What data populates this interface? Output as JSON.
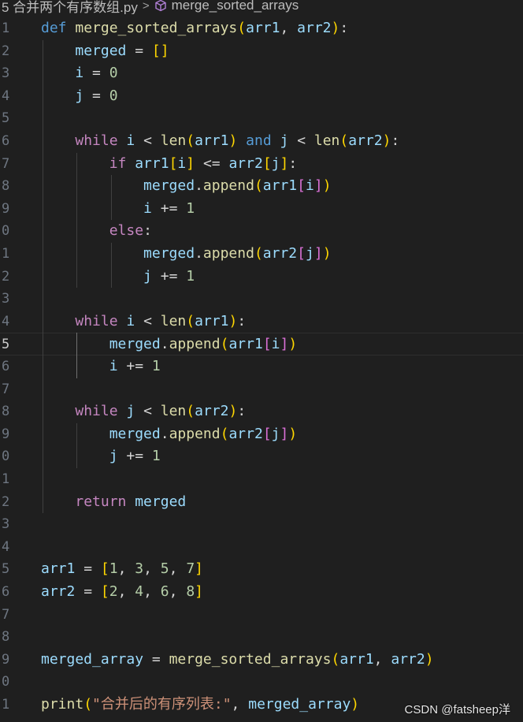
{
  "breadcrumb": {
    "file": "5 合并两个有序数组.py",
    "symbol": "merge_sorted_arrays"
  },
  "line_numbers": [
    "1",
    "2",
    "3",
    "4",
    "5",
    "6",
    "7",
    "8",
    "9",
    "0",
    "1",
    "2",
    "3",
    "4",
    "5",
    "6",
    "7",
    "8",
    "9",
    "0",
    "1",
    "2",
    "3",
    "4",
    "5",
    "6",
    "7",
    "8",
    "9",
    "0",
    "1"
  ],
  "active_line_index": 14,
  "code_lines": [
    [
      [
        "kw",
        "def "
      ],
      [
        "fn",
        "merge_sorted_arrays"
      ],
      [
        "b1",
        "("
      ],
      [
        "var",
        "arr1"
      ],
      [
        "op",
        ", "
      ],
      [
        "var",
        "arr2"
      ],
      [
        "b1",
        ")"
      ],
      [
        "op",
        ":"
      ]
    ],
    [
      [
        "op",
        "    "
      ],
      [
        "var",
        "merged"
      ],
      [
        "op",
        " = "
      ],
      [
        "b1",
        "[]"
      ]
    ],
    [
      [
        "op",
        "    "
      ],
      [
        "var",
        "i"
      ],
      [
        "op",
        " = "
      ],
      [
        "num",
        "0"
      ]
    ],
    [
      [
        "op",
        "    "
      ],
      [
        "var",
        "j"
      ],
      [
        "op",
        " = "
      ],
      [
        "num",
        "0"
      ]
    ],
    [],
    [
      [
        "op",
        "    "
      ],
      [
        "ctl",
        "while "
      ],
      [
        "var",
        "i"
      ],
      [
        "op",
        " < "
      ],
      [
        "fn",
        "len"
      ],
      [
        "b1",
        "("
      ],
      [
        "var",
        "arr1"
      ],
      [
        "b1",
        ")"
      ],
      [
        "op",
        " "
      ],
      [
        "kw",
        "and"
      ],
      [
        "op",
        " "
      ],
      [
        "var",
        "j"
      ],
      [
        "op",
        " < "
      ],
      [
        "fn",
        "len"
      ],
      [
        "b1",
        "("
      ],
      [
        "var",
        "arr2"
      ],
      [
        "b1",
        ")"
      ],
      [
        "op",
        ":"
      ]
    ],
    [
      [
        "op",
        "        "
      ],
      [
        "ctl",
        "if "
      ],
      [
        "var",
        "arr1"
      ],
      [
        "b1",
        "["
      ],
      [
        "var",
        "i"
      ],
      [
        "b1",
        "]"
      ],
      [
        "op",
        " <= "
      ],
      [
        "var",
        "arr2"
      ],
      [
        "b1",
        "["
      ],
      [
        "var",
        "j"
      ],
      [
        "b1",
        "]"
      ],
      [
        "op",
        ":"
      ]
    ],
    [
      [
        "op",
        "            "
      ],
      [
        "var",
        "merged"
      ],
      [
        "op",
        "."
      ],
      [
        "fn",
        "append"
      ],
      [
        "b1",
        "("
      ],
      [
        "var",
        "arr1"
      ],
      [
        "b2",
        "["
      ],
      [
        "var",
        "i"
      ],
      [
        "b2",
        "]"
      ],
      [
        "b1",
        ")"
      ]
    ],
    [
      [
        "op",
        "            "
      ],
      [
        "var",
        "i"
      ],
      [
        "op",
        " += "
      ],
      [
        "num",
        "1"
      ]
    ],
    [
      [
        "op",
        "        "
      ],
      [
        "ctl",
        "else"
      ],
      [
        "op",
        ":"
      ]
    ],
    [
      [
        "op",
        "            "
      ],
      [
        "var",
        "merged"
      ],
      [
        "op",
        "."
      ],
      [
        "fn",
        "append"
      ],
      [
        "b1",
        "("
      ],
      [
        "var",
        "arr2"
      ],
      [
        "b2",
        "["
      ],
      [
        "var",
        "j"
      ],
      [
        "b2",
        "]"
      ],
      [
        "b1",
        ")"
      ]
    ],
    [
      [
        "op",
        "            "
      ],
      [
        "var",
        "j"
      ],
      [
        "op",
        " += "
      ],
      [
        "num",
        "1"
      ]
    ],
    [],
    [
      [
        "op",
        "    "
      ],
      [
        "ctl",
        "while "
      ],
      [
        "var",
        "i"
      ],
      [
        "op",
        " < "
      ],
      [
        "fn",
        "len"
      ],
      [
        "b1",
        "("
      ],
      [
        "var",
        "arr1"
      ],
      [
        "b1",
        ")"
      ],
      [
        "op",
        ":"
      ]
    ],
    [
      [
        "op",
        "        "
      ],
      [
        "var",
        "merged"
      ],
      [
        "op",
        "."
      ],
      [
        "fn",
        "append"
      ],
      [
        "b1",
        "("
      ],
      [
        "var",
        "arr1"
      ],
      [
        "b2",
        "["
      ],
      [
        "var",
        "i"
      ],
      [
        "b2",
        "]"
      ],
      [
        "b1",
        ")"
      ]
    ],
    [
      [
        "op",
        "        "
      ],
      [
        "var",
        "i"
      ],
      [
        "op",
        " += "
      ],
      [
        "num",
        "1"
      ]
    ],
    [],
    [
      [
        "op",
        "    "
      ],
      [
        "ctl",
        "while "
      ],
      [
        "var",
        "j"
      ],
      [
        "op",
        " < "
      ],
      [
        "fn",
        "len"
      ],
      [
        "b1",
        "("
      ],
      [
        "var",
        "arr2"
      ],
      [
        "b1",
        ")"
      ],
      [
        "op",
        ":"
      ]
    ],
    [
      [
        "op",
        "        "
      ],
      [
        "var",
        "merged"
      ],
      [
        "op",
        "."
      ],
      [
        "fn",
        "append"
      ],
      [
        "b1",
        "("
      ],
      [
        "var",
        "arr2"
      ],
      [
        "b2",
        "["
      ],
      [
        "var",
        "j"
      ],
      [
        "b2",
        "]"
      ],
      [
        "b1",
        ")"
      ]
    ],
    [
      [
        "op",
        "        "
      ],
      [
        "var",
        "j"
      ],
      [
        "op",
        " += "
      ],
      [
        "num",
        "1"
      ]
    ],
    [],
    [
      [
        "op",
        "    "
      ],
      [
        "ctl",
        "return "
      ],
      [
        "var",
        "merged"
      ]
    ],
    [],
    [],
    [
      [
        "var",
        "arr1"
      ],
      [
        "op",
        " = "
      ],
      [
        "b1",
        "["
      ],
      [
        "num",
        "1"
      ],
      [
        "op",
        ", "
      ],
      [
        "num",
        "3"
      ],
      [
        "op",
        ", "
      ],
      [
        "num",
        "5"
      ],
      [
        "op",
        ", "
      ],
      [
        "num",
        "7"
      ],
      [
        "b1",
        "]"
      ]
    ],
    [
      [
        "var",
        "arr2"
      ],
      [
        "op",
        " = "
      ],
      [
        "b1",
        "["
      ],
      [
        "num",
        "2"
      ],
      [
        "op",
        ", "
      ],
      [
        "num",
        "4"
      ],
      [
        "op",
        ", "
      ],
      [
        "num",
        "6"
      ],
      [
        "op",
        ", "
      ],
      [
        "num",
        "8"
      ],
      [
        "b1",
        "]"
      ]
    ],
    [],
    [],
    [
      [
        "var",
        "merged_array"
      ],
      [
        "op",
        " = "
      ],
      [
        "fn",
        "merge_sorted_arrays"
      ],
      [
        "b1",
        "("
      ],
      [
        "var",
        "arr1"
      ],
      [
        "op",
        ", "
      ],
      [
        "var",
        "arr2"
      ],
      [
        "b1",
        ")"
      ]
    ],
    [],
    [
      [
        "fn",
        "print"
      ],
      [
        "b1",
        "("
      ],
      [
        "str",
        "\"合并后的有序列表:\""
      ],
      [
        "op",
        ", "
      ],
      [
        "var",
        "merged_array"
      ],
      [
        "b1",
        ")"
      ]
    ]
  ],
  "watermark": "CSDN @fatsheep洋"
}
